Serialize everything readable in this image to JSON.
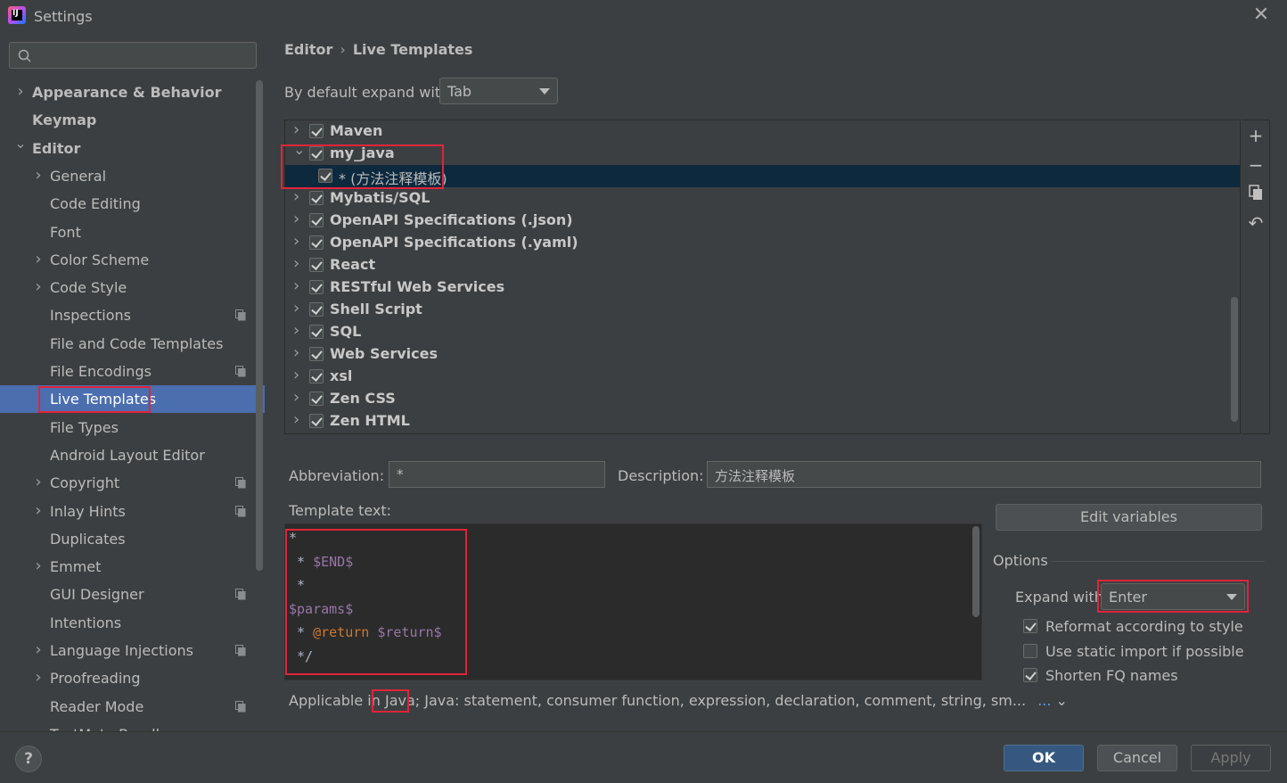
{
  "window": {
    "title": "Settings",
    "app_icon_text": "IJ"
  },
  "sidebar": {
    "search_placeholder": "",
    "items": [
      {
        "label": "Appearance & Behavior",
        "bold": true,
        "chevron": ">",
        "level": 0
      },
      {
        "label": "Keymap",
        "bold": true,
        "chevron": "",
        "level": 0
      },
      {
        "label": "Editor",
        "bold": true,
        "chevron": "v",
        "level": 0
      },
      {
        "label": "General",
        "chevron": ">",
        "level": 1
      },
      {
        "label": "Code Editing",
        "chevron": "",
        "level": 1
      },
      {
        "label": "Font",
        "chevron": "",
        "level": 1
      },
      {
        "label": "Color Scheme",
        "chevron": ">",
        "level": 1
      },
      {
        "label": "Code Style",
        "chevron": ">",
        "level": 1
      },
      {
        "label": "Inspections",
        "chevron": "",
        "level": 1,
        "copy_icon": true
      },
      {
        "label": "File and Code Templates",
        "chevron": "",
        "level": 1
      },
      {
        "label": "File Encodings",
        "chevron": "",
        "level": 1,
        "copy_icon": true
      },
      {
        "label": "Live Templates",
        "chevron": "",
        "level": 1,
        "selected": true
      },
      {
        "label": "File Types",
        "chevron": "",
        "level": 1
      },
      {
        "label": "Android Layout Editor",
        "chevron": "",
        "level": 1
      },
      {
        "label": "Copyright",
        "chevron": ">",
        "level": 1,
        "copy_icon": true
      },
      {
        "label": "Inlay Hints",
        "chevron": ">",
        "level": 1,
        "copy_icon": true
      },
      {
        "label": "Duplicates",
        "chevron": "",
        "level": 1
      },
      {
        "label": "Emmet",
        "chevron": ">",
        "level": 1
      },
      {
        "label": "GUI Designer",
        "chevron": "",
        "level": 1,
        "copy_icon": true
      },
      {
        "label": "Intentions",
        "chevron": "",
        "level": 1
      },
      {
        "label": "Language Injections",
        "chevron": ">",
        "level": 1,
        "copy_icon": true
      },
      {
        "label": "Proofreading",
        "chevron": ">",
        "level": 1
      },
      {
        "label": "Reader Mode",
        "chevron": "",
        "level": 1,
        "copy_icon": true
      },
      {
        "label": "TextMate Bundles",
        "chevron": "",
        "level": 1
      }
    ]
  },
  "breadcrumb": {
    "parent": "Editor",
    "separator": "›",
    "current": "Live Templates"
  },
  "expand_default": {
    "label": "By default expand with",
    "value": "Tab"
  },
  "template_groups": [
    {
      "label": "Maven",
      "bold": true,
      "checked": true,
      "expanded": false,
      "level": 0
    },
    {
      "label": "my_java",
      "bold": true,
      "checked": true,
      "expanded": true,
      "level": 0
    },
    {
      "label": "* (方法注释模板)",
      "bold": false,
      "checked": true,
      "level": 1,
      "selected": true
    },
    {
      "label": "Mybatis/SQL",
      "bold": true,
      "checked": true,
      "expanded": false,
      "level": 0
    },
    {
      "label": "OpenAPI Specifications (.json)",
      "bold": true,
      "checked": true,
      "expanded": false,
      "level": 0
    },
    {
      "label": "OpenAPI Specifications (.yaml)",
      "bold": true,
      "checked": true,
      "expanded": false,
      "level": 0
    },
    {
      "label": "React",
      "bold": true,
      "checked": true,
      "expanded": false,
      "level": 0
    },
    {
      "label": "RESTful Web Services",
      "bold": true,
      "checked": true,
      "expanded": false,
      "level": 0
    },
    {
      "label": "Shell Script",
      "bold": true,
      "checked": true,
      "expanded": false,
      "level": 0
    },
    {
      "label": "SQL",
      "bold": true,
      "checked": true,
      "expanded": false,
      "level": 0
    },
    {
      "label": "Web Services",
      "bold": true,
      "checked": true,
      "expanded": false,
      "level": 0
    },
    {
      "label": "xsl",
      "bold": true,
      "checked": true,
      "expanded": false,
      "level": 0
    },
    {
      "label": "Zen CSS",
      "bold": true,
      "checked": true,
      "expanded": false,
      "level": 0
    },
    {
      "label": "Zen HTML",
      "bold": true,
      "checked": true,
      "expanded": false,
      "level": 0
    }
  ],
  "toolbar": {
    "add_icon": "+",
    "remove_icon": "−",
    "copy_icon": "copy-icon",
    "restore_icon": "↶"
  },
  "abbreviation": {
    "label": "Abbreviation:",
    "value": "*"
  },
  "description": {
    "label": "Description:",
    "value": "方法注释模板"
  },
  "template_text": {
    "label": "Template text:",
    "lines": [
      [
        {
          "t": "*",
          "c": ""
        }
      ],
      [
        {
          "t": " * ",
          "c": ""
        },
        {
          "t": "$END$",
          "c": "var"
        }
      ],
      [
        {
          "t": " *",
          "c": ""
        }
      ],
      [
        {
          "t": "$params$",
          "c": "var"
        }
      ],
      [
        {
          "t": " * ",
          "c": ""
        },
        {
          "t": "@return",
          "c": "kw"
        },
        {
          "t": " ",
          "c": ""
        },
        {
          "t": "$return$",
          "c": "var"
        }
      ],
      [
        {
          "t": " */",
          "c": ""
        }
      ]
    ]
  },
  "applicable": {
    "prefix": "Applicable in",
    "highlight": "Java;",
    "rest": "Java: statement, consumer function, expression, declaration, comment, string, sm...",
    "more": "...",
    "chevron": "⌄"
  },
  "edit_variables_label": "Edit variables",
  "options": {
    "title": "Options",
    "expand_with_label": "Expand with",
    "expand_with_value": "Enter",
    "checks": [
      {
        "label": "Reformat according to style",
        "checked": true
      },
      {
        "label": "Use static import if possible",
        "checked": false
      },
      {
        "label": "Shorten FQ names",
        "checked": true
      }
    ]
  },
  "footer": {
    "help": "?",
    "ok": "OK",
    "cancel": "Cancel",
    "apply": "Apply"
  },
  "colors": {
    "accent": "#4b6eaf",
    "highlight_box": "#e0243b",
    "selected_row": "#0d293e"
  }
}
